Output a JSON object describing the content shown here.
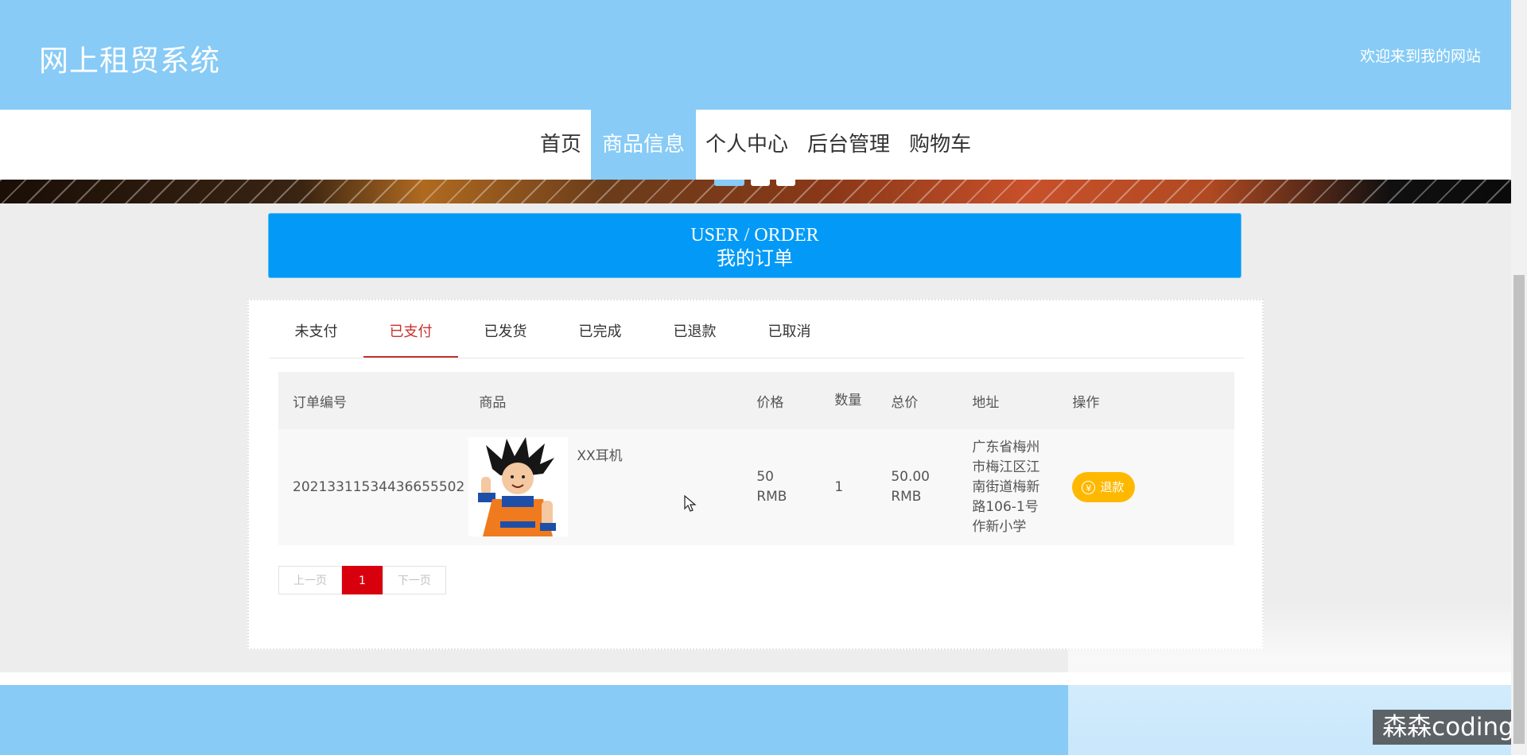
{
  "header": {
    "title": "网上租贸系统",
    "welcome": "欢迎来到我的网站"
  },
  "nav": {
    "items": [
      {
        "label": "首页"
      },
      {
        "label": "商品信息",
        "active": true
      },
      {
        "label": "个人中心"
      },
      {
        "label": "后台管理"
      },
      {
        "label": "购物车"
      }
    ]
  },
  "page_title": {
    "en": "USER / ORDER",
    "cn": "我的订单"
  },
  "tabs": [
    {
      "label": "未支付"
    },
    {
      "label": "已支付",
      "active": true
    },
    {
      "label": "已发货"
    },
    {
      "label": "已完成"
    },
    {
      "label": "已退款"
    },
    {
      "label": "已取消"
    }
  ],
  "table": {
    "headers": [
      "订单编号",
      "商品",
      "价格",
      "数量",
      "总价",
      "地址",
      "操作"
    ],
    "rows": [
      {
        "order_no": "20213311534436655502",
        "product": "XX耳机",
        "price": "50 RMB",
        "qty": "1",
        "total": "50.00 RMB",
        "address": "广东省梅州市梅江区江南街道梅新路106-1号作新小学",
        "action": "退款"
      }
    ]
  },
  "pagination": {
    "prev": "上一页",
    "current": "1",
    "next": "下一页"
  },
  "watermark": "森森coding",
  "colors": {
    "header": "#87cbf6",
    "title_box": "#039af7",
    "active_tab": "#c9302c",
    "refund": "#ffb800",
    "page_current": "#d9000e"
  }
}
